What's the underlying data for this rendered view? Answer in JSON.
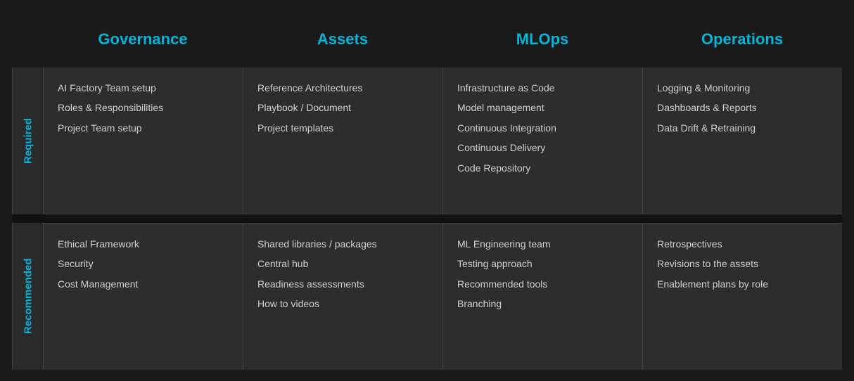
{
  "headers": {
    "corner": "",
    "governance": "Governance",
    "assets": "Assets",
    "mlops": "MLOps",
    "operations": "Operations"
  },
  "row_labels": {
    "required": "Required",
    "recommended": "Recommended"
  },
  "required": {
    "governance": [
      "AI Factory Team setup",
      "Roles & Responsibilities",
      "Project Team setup"
    ],
    "assets": [
      "Reference Architectures",
      "Playbook / Document",
      "Project templates"
    ],
    "mlops": [
      "Infrastructure as Code",
      "Model management",
      "Continuous Integration",
      "Continuous Delivery",
      "Code Repository"
    ],
    "operations": [
      "Logging & Monitoring",
      "Dashboards & Reports",
      "Data Drift & Retraining"
    ]
  },
  "recommended": {
    "governance": [
      "Ethical Framework",
      "Security",
      "Cost Management"
    ],
    "assets": [
      "Shared libraries / packages",
      "Central hub",
      "Readiness assessments",
      "How to videos"
    ],
    "mlops": [
      "ML Engineering team",
      "Testing approach",
      "Recommended tools",
      "Branching"
    ],
    "operations": [
      "Retrospectives",
      "Revisions to the assets",
      "Enablement plans by role"
    ]
  }
}
